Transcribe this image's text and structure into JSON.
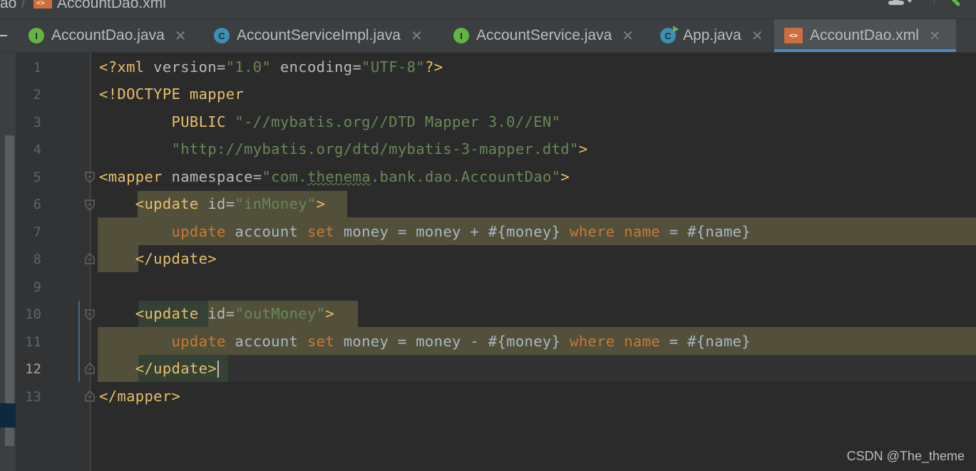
{
  "breadcrumb": {
    "folder": "ao",
    "file": "AccountDao.xml"
  },
  "tabs": [
    {
      "label": "AccountDao.java",
      "icon": "interface-icon",
      "icon_letter": "I",
      "active": false
    },
    {
      "label": "AccountServiceImpl.java",
      "icon": "class-icon",
      "icon_letter": "C",
      "active": false
    },
    {
      "label": "AccountService.java",
      "icon": "interface-icon",
      "icon_letter": "I",
      "active": false
    },
    {
      "label": "App.java",
      "icon": "runnable-class-icon",
      "icon_letter": "C",
      "active": false
    },
    {
      "label": "AccountDao.xml",
      "icon": "xml-file-icon",
      "icon_letter": "<>",
      "active": true
    }
  ],
  "editor": {
    "line_numbers": [
      "1",
      "2",
      "3",
      "4",
      "5",
      "6",
      "7",
      "8",
      "9",
      "10",
      "11",
      "12",
      "13"
    ],
    "current_line": "12",
    "lines": [
      [
        "<?xml ",
        "version",
        "=",
        "\"1.0\"",
        " ",
        "encoding",
        "=",
        "\"UTF-8\"",
        "?>"
      ],
      [
        "<!DOCTYPE mapper"
      ],
      [
        "        PUBLIC ",
        "\"-//mybatis.org//DTD Mapper 3.0//EN\""
      ],
      [
        "        ",
        "\"http://mybatis.org/dtd/mybatis-3-mapper.dtd\"",
        ">"
      ],
      [
        "<mapper ",
        "namespace",
        "=",
        "\"com.",
        "thenema",
        ".bank.dao.AccountDao\"",
        ">"
      ],
      [
        "    <update ",
        "id",
        "=",
        "\"inMoney\"",
        ">"
      ],
      [
        "        ",
        "update",
        " account ",
        "set",
        " money = money + #{money} ",
        "where",
        " ",
        "name",
        " = #{name}"
      ],
      [
        "    </update>"
      ],
      [
        ""
      ],
      [
        "    ",
        "<update",
        " ",
        "id",
        "=",
        "\"outMoney\"",
        ">"
      ],
      [
        "        ",
        "update",
        " account ",
        "set",
        " money = money - #{money} ",
        "where",
        " ",
        "name",
        " = #{name}"
      ],
      [
        "    ",
        "</update>"
      ],
      [
        "</mapper>"
      ]
    ]
  },
  "watermark": "CSDN @The_theme",
  "colors": {
    "background": "#2b2b2b",
    "tag": "#e8bf6a",
    "attribute_value": "#6a8759",
    "sql_keyword": "#cc7832",
    "injected_highlight": "#52503a",
    "active_tab_underline": "#4a88c7"
  }
}
